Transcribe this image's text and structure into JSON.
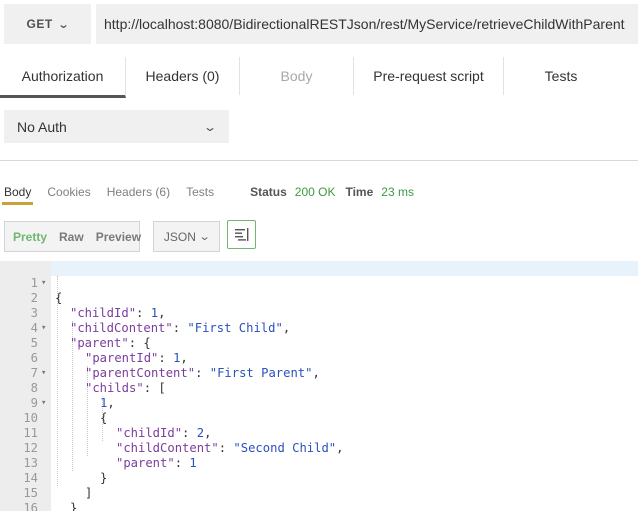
{
  "request": {
    "method": "GET",
    "url": "http://localhost:8080/BidirectionalRESTJson/rest/MyService/retrieveChildWithParent"
  },
  "request_tabs": [
    {
      "label": "Authorization"
    },
    {
      "label": "Headers (0)"
    },
    {
      "label": "Body"
    },
    {
      "label": "Pre-request script"
    },
    {
      "label": "Tests"
    }
  ],
  "auth": {
    "selected": "No Auth"
  },
  "response_tabs": [
    {
      "label": "Body"
    },
    {
      "label": "Cookies"
    },
    {
      "label": "Headers (6)"
    },
    {
      "label": "Tests"
    }
  ],
  "status": {
    "status_label": "Status",
    "status_value": "200 OK",
    "time_label": "Time",
    "time_value": "23 ms"
  },
  "view_modes": [
    {
      "label": "Pretty"
    },
    {
      "label": "Raw"
    },
    {
      "label": "Preview"
    }
  ],
  "format": {
    "selected": "JSON"
  },
  "icons": {
    "method_dropdown": "chevron-down-icon",
    "auth_dropdown": "chevron-down-icon",
    "format_dropdown": "chevron-down-icon",
    "wrap": "wrap-lines-icon",
    "fold": "fold-arrow-icon"
  },
  "colors": {
    "status_ok": "#3e9a3e",
    "active_tab_underline": "#c8a236",
    "json_key": "#7a3e9d",
    "json_value": "#2a52be",
    "pretty_active": "#6fb86f"
  },
  "code_lines": [
    {
      "num": "1",
      "fold": true
    },
    {
      "num": "2",
      "fold": false
    },
    {
      "num": "3",
      "fold": false
    },
    {
      "num": "4",
      "fold": true
    },
    {
      "num": "5",
      "fold": false
    },
    {
      "num": "6",
      "fold": false
    },
    {
      "num": "7",
      "fold": true
    },
    {
      "num": "8",
      "fold": false
    },
    {
      "num": "9",
      "fold": true
    },
    {
      "num": "10",
      "fold": false
    },
    {
      "num": "11",
      "fold": false
    },
    {
      "num": "12",
      "fold": false
    },
    {
      "num": "13",
      "fold": false
    },
    {
      "num": "14",
      "fold": false
    },
    {
      "num": "15",
      "fold": false
    },
    {
      "num": "16",
      "fold": false
    }
  ],
  "code": {
    "l1": {
      "p": "{"
    },
    "l2": {
      "k": "\"childId\"",
      "p": ": ",
      "v": "1",
      "e": ","
    },
    "l3": {
      "k": "\"childContent\"",
      "p": ": ",
      "v": "\"First Child\"",
      "e": ","
    },
    "l4": {
      "k": "\"parent\"",
      "p": ": {"
    },
    "l5": {
      "k": "\"parentId\"",
      "p": ": ",
      "v": "1",
      "e": ","
    },
    "l6": {
      "k": "\"parentContent\"",
      "p": ": ",
      "v": "\"First Parent\"",
      "e": ","
    },
    "l7": {
      "k": "\"childs\"",
      "p": ": ["
    },
    "l8": {
      "v": "1",
      "e": ","
    },
    "l9": {
      "p": "{"
    },
    "l10": {
      "k": "\"childId\"",
      "p": ": ",
      "v": "2",
      "e": ","
    },
    "l11": {
      "k": "\"childContent\"",
      "p": ": ",
      "v": "\"Second Child\"",
      "e": ","
    },
    "l12": {
      "k": "\"parent\"",
      "p": ": ",
      "v": "1"
    },
    "l13": {
      "p": "}"
    },
    "l14": {
      "p": "]"
    },
    "l15": {
      "p": "}"
    },
    "l16": {
      "p": "}"
    }
  }
}
